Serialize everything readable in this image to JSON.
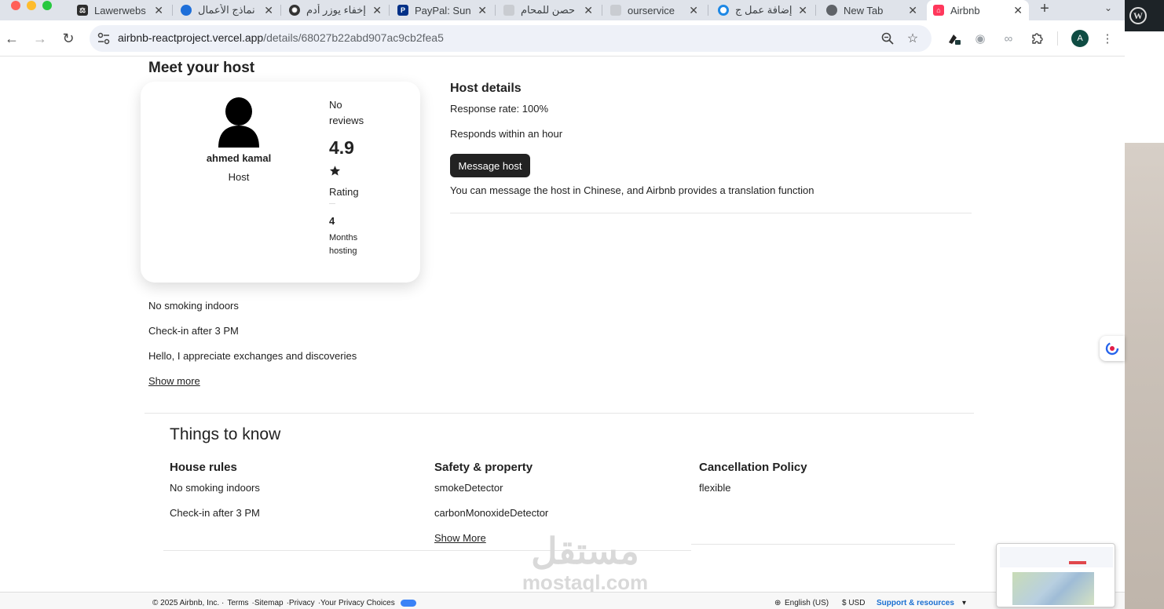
{
  "browser": {
    "tabs": [
      {
        "title": "Lawerwebs",
        "favicon_color": "#2d2d2d"
      },
      {
        "title": "نماذج الأعمال",
        "favicon_color": "#1e6fd9"
      },
      {
        "title": "إخفاء يوزر أدم",
        "favicon_color": "#333333"
      },
      {
        "title": "PayPal: Sun",
        "favicon_color": "#003087"
      },
      {
        "title": "حصن للمحام",
        "favicon_color": "#9aa0a6"
      },
      {
        "title": "ourservice",
        "favicon_color": "#9aa0a6"
      },
      {
        "title": "إضافة عمل ج",
        "favicon_color": "#1e88e5"
      },
      {
        "title": "New Tab",
        "favicon_color": "#5f6368"
      },
      {
        "title": "Airbnb",
        "favicon_color": "#ff385c"
      }
    ],
    "active_tab_index": 8,
    "new_tab_label": "+",
    "url_host": "airbnb-reactproject.vercel.app",
    "url_path": "/details/68027b22abd907ac9cb2fea5",
    "profile_initial": "A"
  },
  "host": {
    "section_title": "Meet your host",
    "name": "ahmed kamal",
    "role": "Host",
    "reviews_label": "No reviews",
    "rating": "4.9",
    "rating_label": "Rating",
    "months": "4",
    "months_label": "Months hosting"
  },
  "host_details": {
    "title": "Host details",
    "response_rate": "Response rate: 100%",
    "response_time": "Responds within an hour",
    "message_button": "Message host",
    "translation_note": "You can message the host in Chinese, and Airbnb provides a translation function"
  },
  "host_rules": {
    "lines": [
      "No smoking indoors",
      "Check-in after 3 PM",
      "Hello, I appreciate exchanges and discoveries"
    ],
    "show_more": "Show more"
  },
  "things_to_know": {
    "title": "Things to know",
    "house_rules": {
      "title": "House rules",
      "items": [
        "No smoking indoors",
        "Check-in after 3 PM"
      ]
    },
    "safety": {
      "title": "Safety & property",
      "items": [
        "smokeDetector",
        "carbonMonoxideDetector"
      ],
      "show_more": "Show More"
    },
    "cancellation": {
      "title": "Cancellation Policy",
      "items": [
        "flexible"
      ]
    }
  },
  "footer": {
    "copyright": "© 2025 Airbnb, Inc. ·",
    "terms": "Terms",
    "sitemap": "·Sitemap",
    "privacy": "·Privacy",
    "privacy_choices": "·Your Privacy Choices",
    "language": "English (US)",
    "currency": "$ USD",
    "support": "Support & resources"
  },
  "watermark": {
    "arabic": "مستقل",
    "latin": "mostaql.com"
  }
}
